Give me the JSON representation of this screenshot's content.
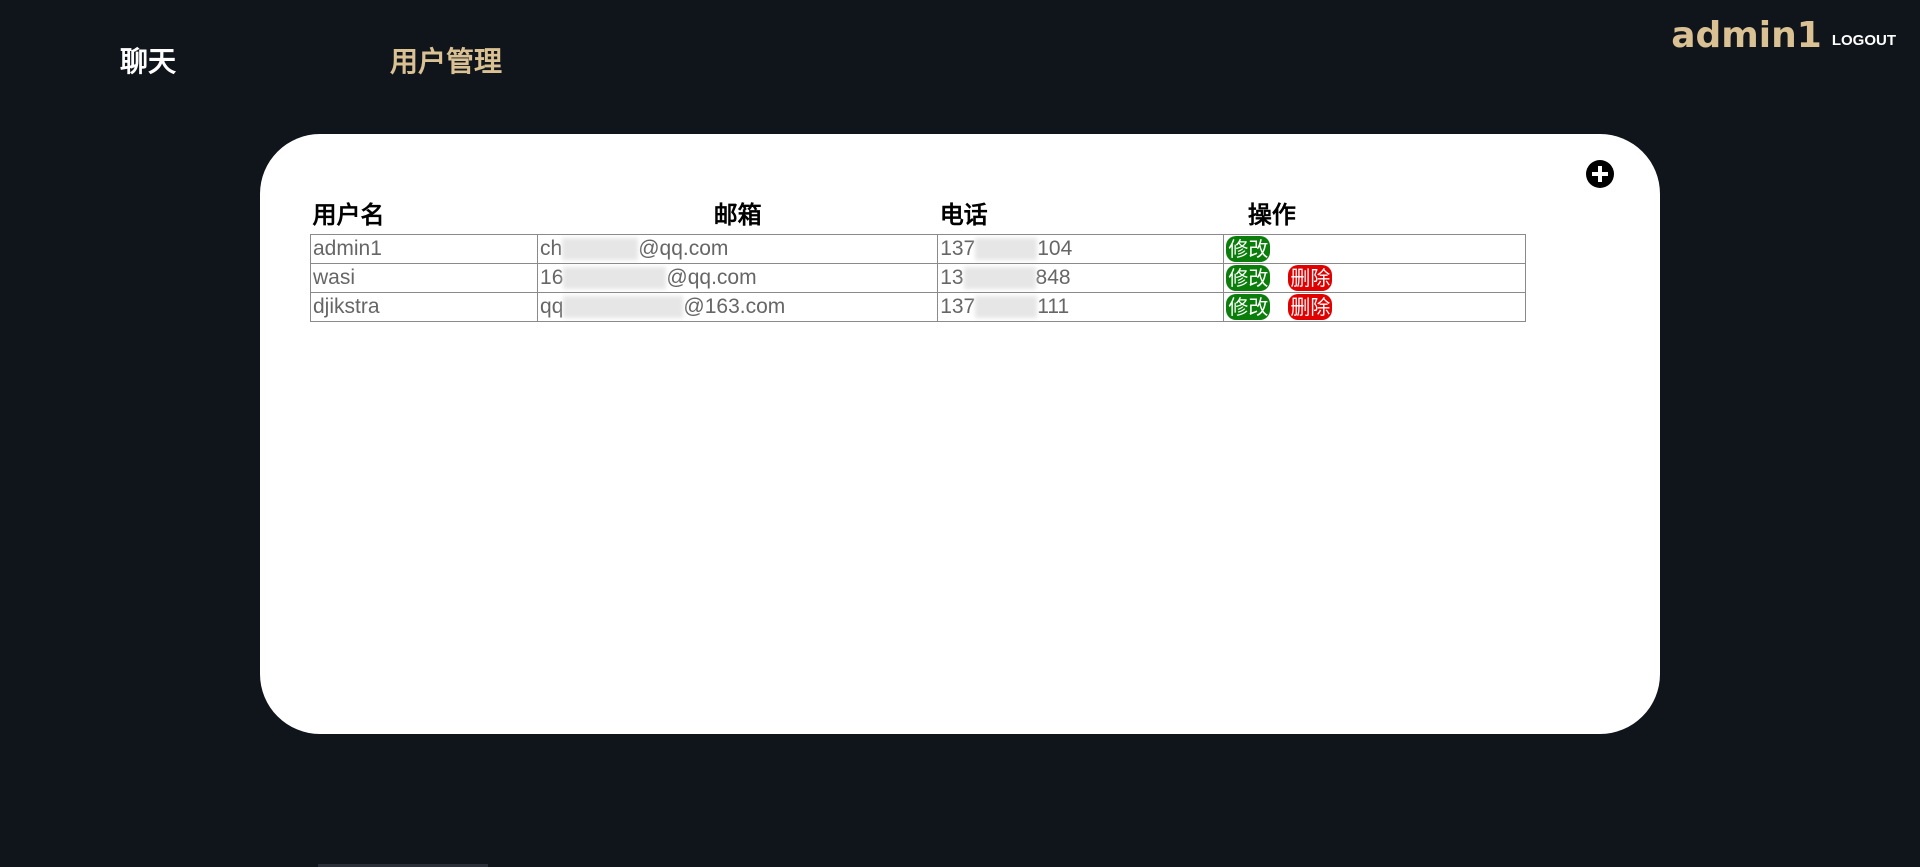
{
  "nav": {
    "chat_label": "聊天",
    "users_label": "用户管理"
  },
  "user": {
    "name": "admin1",
    "logout_label": "LOGOUT"
  },
  "table": {
    "headers": {
      "username": "用户名",
      "email": "邮箱",
      "phone": "电话",
      "actions": "操作"
    },
    "edit_label": "修改",
    "delete_label": "删除",
    "rows": [
      {
        "username": "admin1",
        "email_prefix": "ch",
        "email_suffix": "@qq.com",
        "phone_prefix": "137",
        "phone_suffix": "104",
        "can_delete": false
      },
      {
        "username": "wasi",
        "email_prefix": "16",
        "email_suffix": "@qq.com",
        "phone_prefix": "13",
        "phone_suffix": "848",
        "can_delete": true
      },
      {
        "username": "djikstra",
        "email_prefix": "qq",
        "email_suffix": "@163.com",
        "phone_prefix": "137",
        "phone_suffix": "111",
        "can_delete": true
      }
    ]
  },
  "colors": {
    "background": "#10141b",
    "accent": "#d9c193",
    "edit": "#0b7d0b",
    "delete": "#e00000"
  }
}
